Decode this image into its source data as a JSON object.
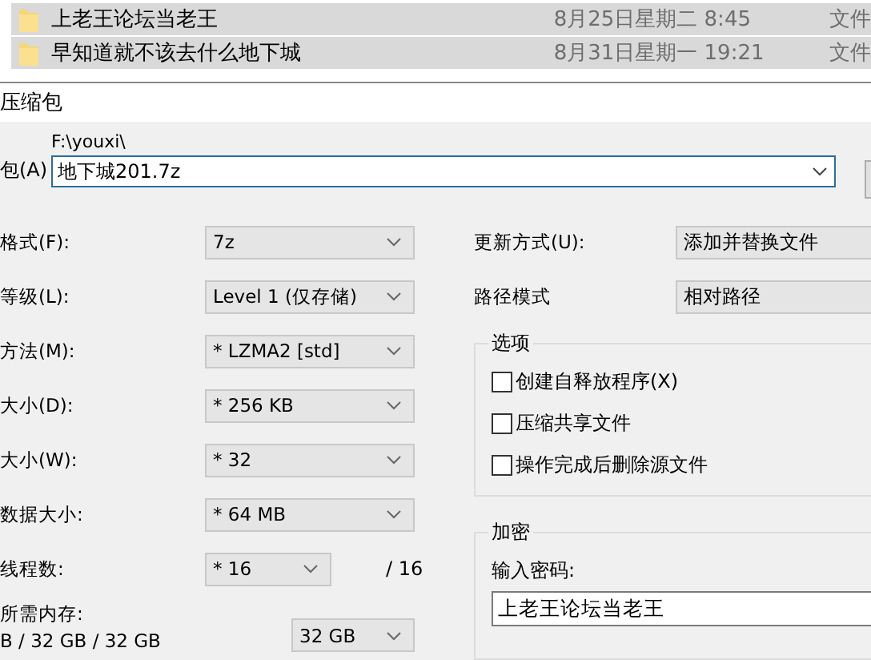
{
  "files": [
    {
      "name": "上老王论坛当老王",
      "date": "8月25日星期二 8:45",
      "type": "文件"
    },
    {
      "name": "早知道就不该去什么地下城",
      "date": "8月31日星期一 19:21",
      "type": "文件"
    }
  ],
  "dialog": {
    "title": "压缩包",
    "archive_label": "包(A)",
    "path": "F:\\youxi\\",
    "archive_name": "地下城201.7z",
    "fields": [
      {
        "label": "格式(F):",
        "value": "7z"
      },
      {
        "label": "等级(L):",
        "value": "Level 1 (仅存储)"
      },
      {
        "label": "方法(M):",
        "value": "* LZMA2 [std]"
      },
      {
        "label": "大小(D):",
        "value": "* 256 KB"
      },
      {
        "label": "大小(W):",
        "value": "* 32"
      },
      {
        "label": "数据大小:",
        "value": "* 64 MB"
      }
    ],
    "threads": {
      "label": "线程数:",
      "value": "* 16",
      "max": "/ 16"
    },
    "memory": {
      "label": "所需内存:",
      "detail": "B / 32 GB / 32 GB",
      "value": "32 GB"
    },
    "update": {
      "label": "更新方式(U):",
      "value": "添加并替换文件"
    },
    "path_mode": {
      "label": "路径模式",
      "value": "相对路径"
    },
    "options": {
      "title": "选项",
      "items": [
        {
          "label": "创建自释放程序(X)",
          "checked": false
        },
        {
          "label": "压缩共享文件",
          "checked": false
        },
        {
          "label": "操作完成后删除源文件",
          "checked": false
        }
      ]
    },
    "encryption": {
      "title": "加密",
      "password_label": "输入密码:",
      "password": "上老王论坛当老王"
    }
  }
}
